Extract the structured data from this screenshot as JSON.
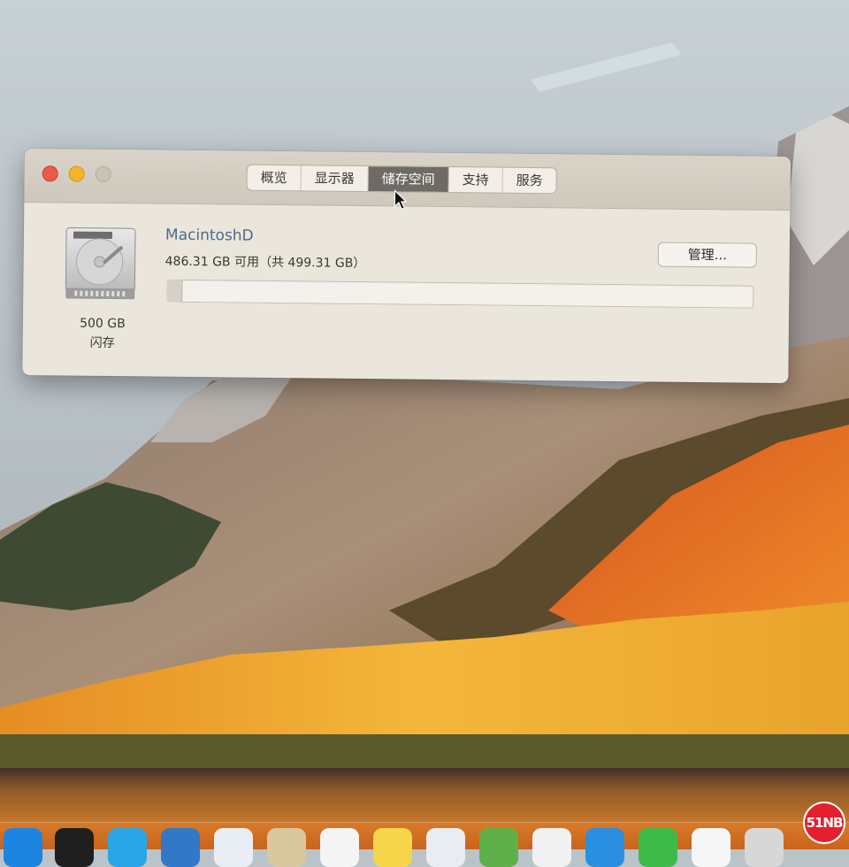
{
  "window": {
    "tabs": [
      {
        "label": "概览",
        "active": false
      },
      {
        "label": "显示器",
        "active": false
      },
      {
        "label": "储存空间",
        "active": true
      },
      {
        "label": "支持",
        "active": false
      },
      {
        "label": "服务",
        "active": false
      }
    ]
  },
  "storage": {
    "disk_name": "MacintoshD",
    "free_text": "486.31 GB 可用（共 499.31 GB）",
    "capacity": "500 GB",
    "type": "闪存",
    "manage_label": "管理...",
    "used_fraction": 0.026
  },
  "watermark": {
    "text": "51NB"
  },
  "colors": {
    "accent_close": "#ec5a4b",
    "accent_minimize": "#f4b42b",
    "active_tab": "#6e6a64",
    "disk_name": "#4b6b8a"
  },
  "icons": [
    "close-icon",
    "minimize-icon",
    "zoom-icon",
    "hard-drive-icon",
    "pointer-cursor-icon"
  ]
}
